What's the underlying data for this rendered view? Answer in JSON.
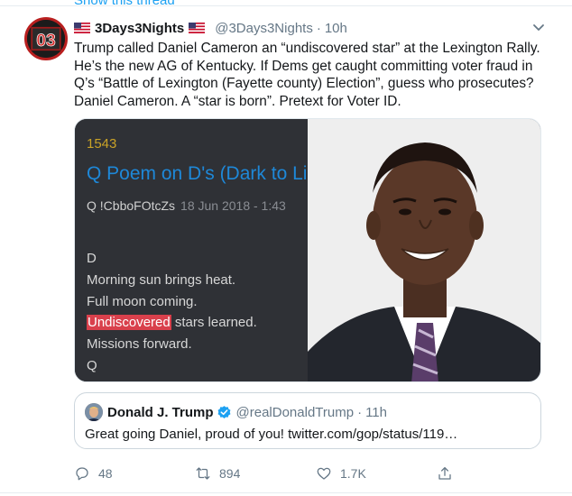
{
  "top_link": "Show this thread",
  "tweet": {
    "display_name": "3Days3Nights",
    "handle": "@3Days3Nights",
    "separator": "·",
    "time": "10h",
    "avatar_text": "03",
    "text_lines": [
      "Trump called Daniel Cameron an “undiscovered star” at the Lexington Rally.",
      "He’s the new AG of Kentucky. If Dems get caught committing voter fraud in",
      "Q’s “Battle of Lexington (Fayette county) Election”, guess who prosecutes?",
      "Daniel Cameron. A “star is born”. Pretext for Voter ID."
    ]
  },
  "media": {
    "q_number": "1543",
    "q_title": "Q Poem on D's (Dark to Li",
    "q_author": "Q !CbboFOtcZs",
    "q_date": "18 Jun 2018 - 1:43",
    "poem_d": "D",
    "poem_line1": "Morning sun brings heat.",
    "poem_line2": "Full moon coming.",
    "poem_highlight": "Undiscovered",
    "poem_line3_rest": " stars learned.",
    "poem_line4": "Missions forward.",
    "poem_sign": "Q"
  },
  "quoted": {
    "display_name": "Donald J. Trump",
    "handle": "@realDonaldTrump",
    "separator": "·",
    "time": "11h",
    "body": "Great going Daniel, proud of you! twitter.com/gop/status/119…"
  },
  "actions": {
    "reply_count": "48",
    "retweet_count": "894",
    "like_count": "1.7K"
  },
  "colors": {
    "link": "#1da1f2",
    "q_highlight": "#d9404c",
    "q_title": "#1e88d8",
    "q_number": "#c9a227"
  },
  "icons": [
    "us-flag-icon",
    "caret-down-icon",
    "verified-badge-icon",
    "reply-icon",
    "retweet-icon",
    "like-icon",
    "share-icon"
  ]
}
